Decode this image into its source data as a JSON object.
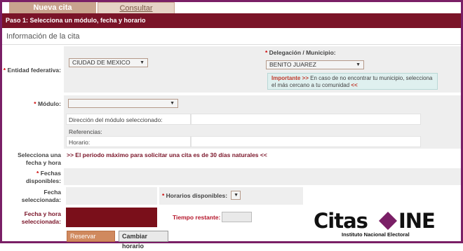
{
  "tabs": [
    {
      "label": "Nueva cita"
    },
    {
      "label": "Consultar"
    }
  ],
  "step_title": "Paso 1: Selecciona un módulo, fecha y horario",
  "section_title": "Información de la cita",
  "entidad": {
    "label": "Entidad federativa:",
    "value": "CIUDAD DE MEXICO"
  },
  "delegacion": {
    "label": "Delegación / Municipio:",
    "value": "BENITO JUAREZ"
  },
  "note": {
    "important": "Importante >>",
    "text": "En caso de no encontrar tu municipio, selecciona el más cercano a tu comunidad",
    "end": "<<"
  },
  "modulo": {
    "label": "Módulo:",
    "value": ""
  },
  "module_info": {
    "direccion": "Dirección del módulo seleccionado:",
    "referencias": "Referencias:",
    "horario": "Horario:"
  },
  "fecha_hora": {
    "label": "Selecciona una fecha y hora",
    "period_note": ">> El periodo máximo para solicitar una cita es de 30 días naturales <<"
  },
  "fechas_disponibles": {
    "label": "Fechas disponibles:"
  },
  "fecha_seleccionada": {
    "label": "Fecha seleccionada:"
  },
  "horarios": {
    "label": "Horarios disponibles:",
    "value": ""
  },
  "fecha_hora_seleccionada": {
    "label": "Fecha y hora seleccionada:"
  },
  "tiempo_restante": {
    "label": "Tiempo restante:"
  },
  "buttons": {
    "reservar": "Reservar horario",
    "cambiar": "Cambiar horario"
  },
  "logo": {
    "text_left": "Citas",
    "text_right": "INE",
    "subtitle": "Instituto Nacional Electoral"
  },
  "colors": {
    "frame": "#7a1f66",
    "step_bar": "#7a1428",
    "tab_active": "#c9a38e",
    "accent_red": "#b5162b"
  }
}
